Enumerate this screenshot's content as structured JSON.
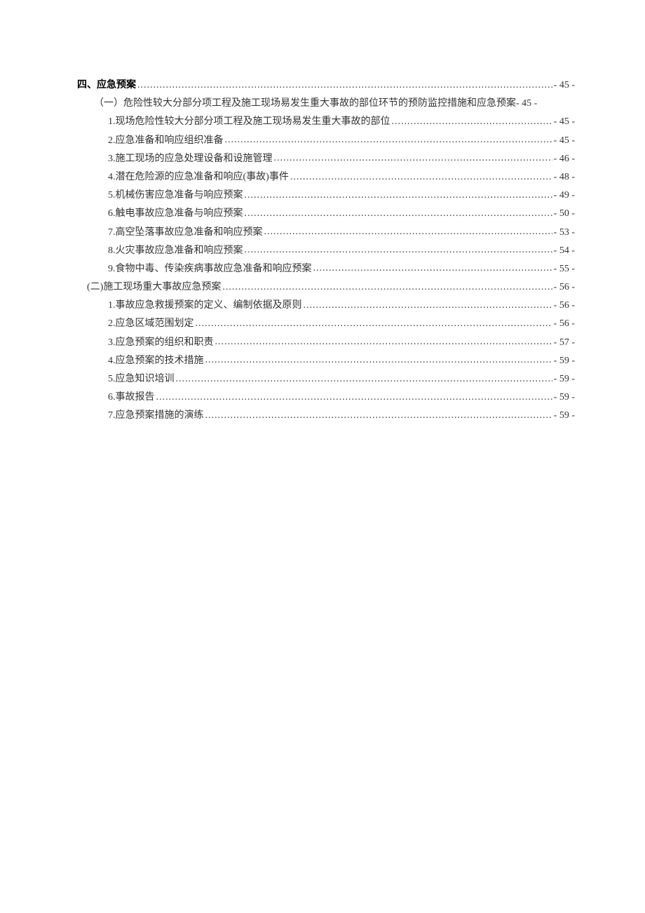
{
  "toc": [
    {
      "level": 0,
      "bold": true,
      "title": "四、应急预案",
      "page": "- 45 -",
      "leader": true
    },
    {
      "level": 1,
      "bold": false,
      "title": "（一）危险性较大分部分项工程及施工现场易发生重大事故的部位环节的预防监控措施和应急预案",
      "page": " - 45 -",
      "leader": false
    },
    {
      "level": 2,
      "bold": false,
      "title": "1.现场危险性较大分部分项工程及施工现场易发生重大事故的部位",
      "page": "- 45 -",
      "leader": true
    },
    {
      "level": 2,
      "bold": false,
      "title": "2.应急准备和响应组织准备",
      "page": "- 45 -",
      "leader": true
    },
    {
      "level": 2,
      "bold": false,
      "title": "3.施工现场的应急处理设备和设施管理",
      "page": "- 46 -",
      "leader": true
    },
    {
      "level": 2,
      "bold": false,
      "title": "4.潜在危险源的应急准备和响应(事故)事件",
      "page": "- 48 -",
      "leader": true
    },
    {
      "level": 2,
      "bold": false,
      "title": "5.机械伤害应急准备与响应预案",
      "page": "- 49 -",
      "leader": true
    },
    {
      "level": 2,
      "bold": false,
      "title": "6.触电事故应急准备与响应预案",
      "page": "- 50 -",
      "leader": true
    },
    {
      "level": 2,
      "bold": false,
      "title": "7.高空坠落事故应急准备和响应预案",
      "page": "- 53 -",
      "leader": true
    },
    {
      "level": 2,
      "bold": false,
      "title": "8.火灾事故应急准备和响应预案",
      "page": "- 54 -",
      "leader": true
    },
    {
      "level": 2,
      "bold": false,
      "title": "9.食物中毒、传染疾病事故应急准备和响应预案",
      "page": "- 55 -",
      "leader": true
    },
    {
      "level": "1b",
      "bold": false,
      "title": "(二)施工现场重大事故应急预案",
      "page": "- 56 -",
      "leader": true
    },
    {
      "level": 2,
      "bold": false,
      "title": "1.事故应急救援预案的定义、编制依据及原则",
      "page": "- 56 -",
      "leader": true
    },
    {
      "level": 2,
      "bold": false,
      "title": "2.应急区域范围划定",
      "page": "- 56 -",
      "leader": true
    },
    {
      "level": 2,
      "bold": false,
      "title": "3.应急预案的组织和职责",
      "page": "- 57 -",
      "leader": true
    },
    {
      "level": 2,
      "bold": false,
      "title": "4.应急预案的技术措施",
      "page": "- 59 -",
      "leader": true
    },
    {
      "level": 2,
      "bold": false,
      "title": "5.应急知识培训",
      "page": "- 59 -",
      "leader": true
    },
    {
      "level": 2,
      "bold": false,
      "title": "6.事故报告",
      "page": "- 59 -",
      "leader": true
    },
    {
      "level": 2,
      "bold": false,
      "title": "7.应急预案措施的演练",
      "page": "- 59 -",
      "leader": true
    }
  ]
}
